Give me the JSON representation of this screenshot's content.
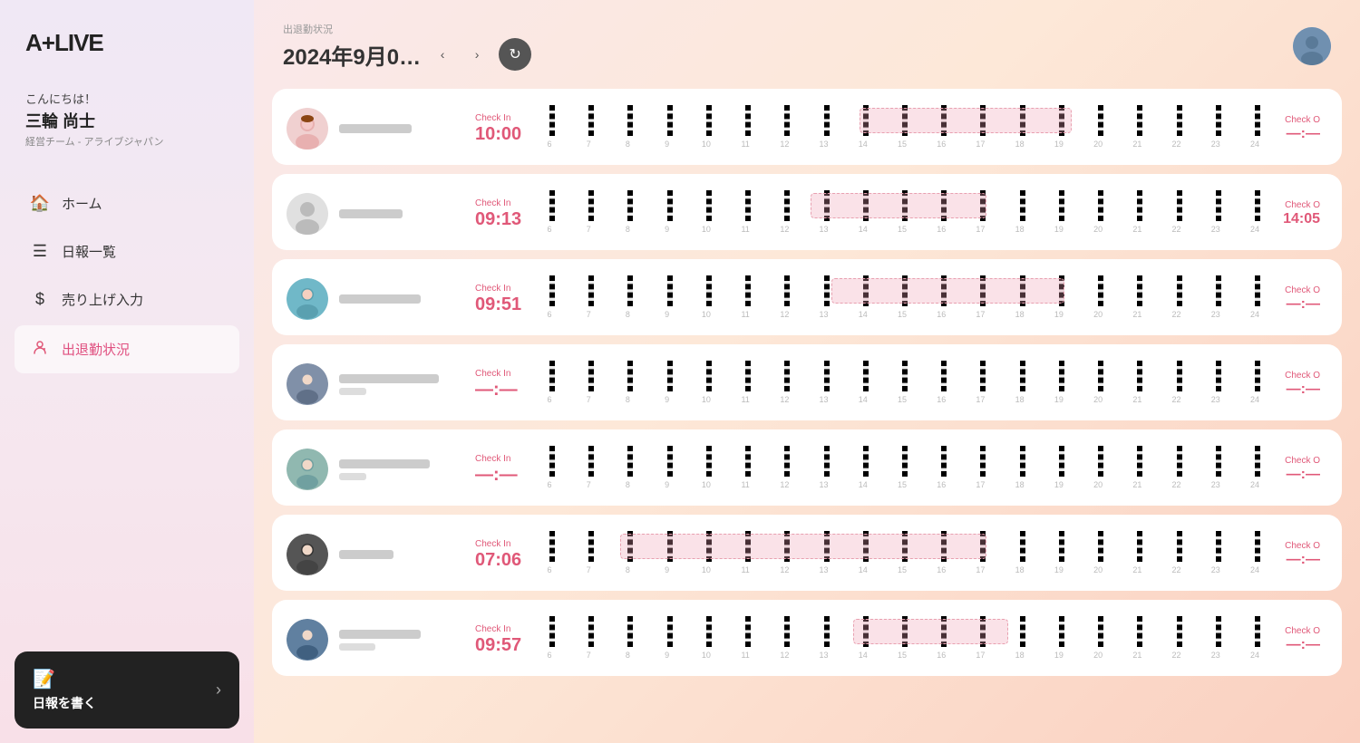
{
  "app": {
    "logo": "A+LIVE"
  },
  "user": {
    "greeting": "こんにちは！",
    "name": "三輪 尚士",
    "team": "経営チーム - アライブジャパン"
  },
  "nav": {
    "items": [
      {
        "id": "home",
        "label": "ホーム",
        "icon": "🏠",
        "active": false
      },
      {
        "id": "reports",
        "label": "日報一覧",
        "icon": "📋",
        "active": false
      },
      {
        "id": "sales",
        "label": "売り上げ入力",
        "icon": "💰",
        "active": false
      },
      {
        "id": "attendance",
        "label": "出退勤状況",
        "icon": "👥",
        "active": true
      }
    ],
    "write_report": {
      "label": "日報を書く",
      "icon": "📝"
    }
  },
  "header": {
    "subtitle": "出退勤状況",
    "title": "2024年9月0…",
    "refresh_icon": "↻"
  },
  "timeline": {
    "hours": [
      "6",
      "7",
      "8",
      "9",
      "10",
      "11",
      "12",
      "13",
      "14",
      "15",
      "16",
      "17",
      "18",
      "19",
      "20",
      "21",
      "22",
      "23",
      "24"
    ]
  },
  "employees": [
    {
      "id": 1,
      "check_in_label": "Check In",
      "check_in_time": "10:00",
      "check_out_label": "Check O",
      "check_out_time": "—:—",
      "bar_start_pct": 44,
      "bar_width_pct": 30,
      "avatar_color": "#e8a0a0",
      "avatar_type": "female1"
    },
    {
      "id": 2,
      "check_in_label": "Check In",
      "check_in_time": "09:13",
      "check_out_label": "Check O",
      "check_out_time": "14:05",
      "bar_start_pct": 37,
      "bar_width_pct": 25,
      "avatar_color": "#cccccc",
      "avatar_type": "generic"
    },
    {
      "id": 3,
      "check_in_label": "Check In",
      "check_in_time": "09:51",
      "check_out_label": "Check O",
      "check_out_time": "—:—",
      "bar_start_pct": 40,
      "bar_width_pct": 33,
      "avatar_color": "#70b8c8",
      "avatar_type": "female2"
    },
    {
      "id": 4,
      "check_in_label": "Check In",
      "check_in_time": "—:—",
      "check_out_label": "Check O",
      "check_out_time": "—:—",
      "bar_start_pct": 0,
      "bar_width_pct": 0,
      "avatar_color": "#8090a8",
      "avatar_type": "male1"
    },
    {
      "id": 5,
      "check_in_label": "Check In",
      "check_in_time": "—:—",
      "check_out_label": "Check O",
      "check_out_time": "—:—",
      "bar_start_pct": 0,
      "bar_width_pct": 0,
      "avatar_color": "#90b8b0",
      "avatar_type": "female3"
    },
    {
      "id": 6,
      "check_in_label": "Check In",
      "check_in_time": "07:06",
      "check_out_label": "Check O",
      "check_out_time": "—:—",
      "bar_start_pct": 10,
      "bar_width_pct": 52,
      "avatar_color": "#555",
      "avatar_type": "male2"
    },
    {
      "id": 7,
      "check_in_label": "Check In",
      "check_in_time": "09:57",
      "check_out_label": "Check O",
      "check_out_time": "—:—",
      "bar_start_pct": 43,
      "bar_width_pct": 22,
      "avatar_color": "#6080a0",
      "avatar_type": "male3"
    }
  ]
}
